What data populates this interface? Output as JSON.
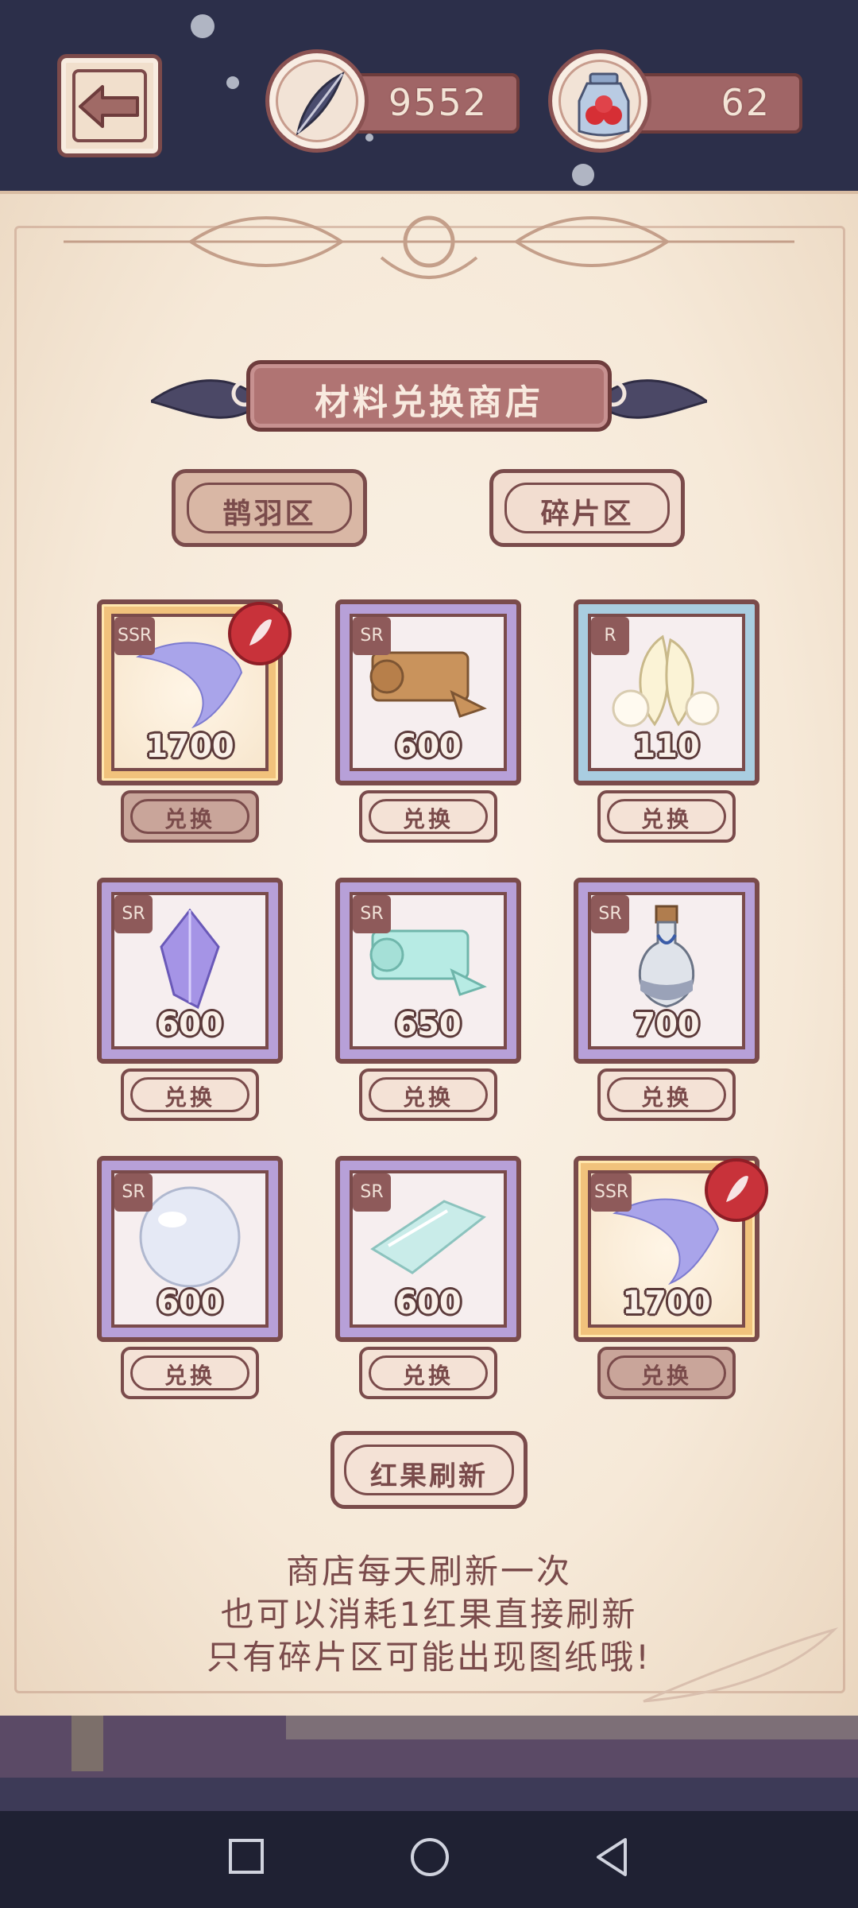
{
  "currencies": {
    "feather": {
      "value": "9552",
      "icon": "feather-icon"
    },
    "redfruit": {
      "value": "62",
      "icon": "red-fruit-jar-icon"
    }
  },
  "shop": {
    "title": "材料兑换商店",
    "tabs": [
      {
        "label": "鹊羽区",
        "active": true
      },
      {
        "label": "碎片区",
        "active": false
      }
    ],
    "items": [
      {
        "rarity": "SSR",
        "price": "1700",
        "art": "ssr-wing-fragment",
        "button": "兑换",
        "sealed": true
      },
      {
        "rarity": "SR",
        "price": "600",
        "art": "cloth-roll",
        "button": "兑换",
        "sealed": false
      },
      {
        "rarity": "R",
        "price": "110",
        "art": "white-feathers",
        "button": "兑换",
        "sealed": false
      },
      {
        "rarity": "SR",
        "price": "600",
        "art": "purple-crystal",
        "button": "兑换",
        "sealed": false
      },
      {
        "rarity": "SR",
        "price": "650",
        "art": "starry-fabric",
        "button": "兑换",
        "sealed": false
      },
      {
        "rarity": "SR",
        "price": "700",
        "art": "potion-bottle",
        "button": "兑换",
        "sealed": false
      },
      {
        "rarity": "SR",
        "price": "600",
        "art": "glass-orb",
        "button": "兑换",
        "sealed": false
      },
      {
        "rarity": "SR",
        "price": "600",
        "art": "glass-sheet",
        "button": "兑换",
        "sealed": false
      },
      {
        "rarity": "SSR",
        "price": "1700",
        "art": "ssr-wing-fragment",
        "button": "兑换",
        "sealed": true
      }
    ],
    "refresh_label": "红果刷新",
    "notes": [
      "商店每天刷新一次",
      "也可以消耗1红果直接刷新",
      "只有碎片区可能出现图纸哦!"
    ]
  },
  "colors": {
    "accent": "#7a4b4b",
    "sr": "#b7a0d8",
    "r": "#a9cde0",
    "ssr": "#f1c27c"
  }
}
